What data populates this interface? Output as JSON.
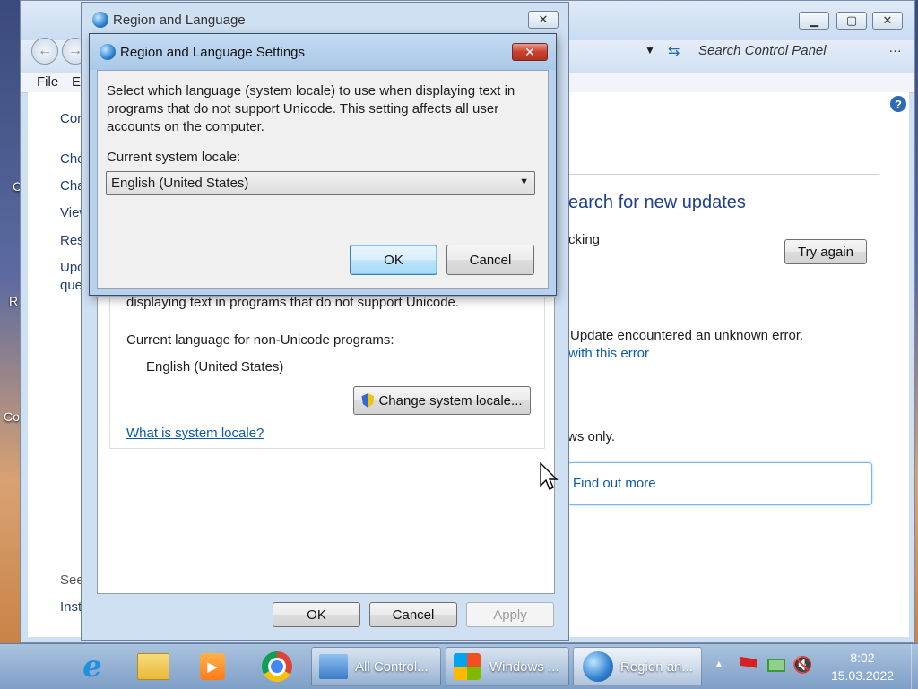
{
  "desktop": {
    "labels": [
      "C",
      "R",
      "Co"
    ]
  },
  "control_panel": {
    "search_placeholder": "Search Control Panel",
    "menu_file": "File",
    "menu_edit_partial": "E",
    "sidebar": [
      "Cor",
      "Che",
      "Cha",
      "View",
      "Res",
      "Upc",
      "que",
      "See",
      "Inst"
    ],
    "update_title": "earch for new updates",
    "checking_text": "cking",
    "try_again": "Try again",
    "error_text": "Update encountered an unknown error.",
    "error_link": "with this error",
    "windows_only": "ws only.",
    "find_out_more": "Find out more"
  },
  "region_language": {
    "title": "Region and Language",
    "unicode_text": "displaying text in programs that do not support Unicode.",
    "current_lang_label": "Current language for non-Unicode programs:",
    "current_lang_value": "English (United States)",
    "change_locale_button": "Change system locale...",
    "what_is_link": "What is system locale?",
    "ok": "OK",
    "cancel": "Cancel",
    "apply": "Apply"
  },
  "settings_dialog": {
    "title": "Region and Language Settings",
    "description": "Select which language (system locale) to use when displaying text in programs that do not support Unicode. This setting affects all user accounts on the computer.",
    "locale_label": "Current system locale:",
    "locale_value": "English (United States)",
    "ok": "OK",
    "cancel": "Cancel"
  },
  "taskbar": {
    "items": [
      "All Control...",
      "Windows ...",
      "Region an..."
    ],
    "time": "8:02",
    "date": "15.03.2022"
  }
}
